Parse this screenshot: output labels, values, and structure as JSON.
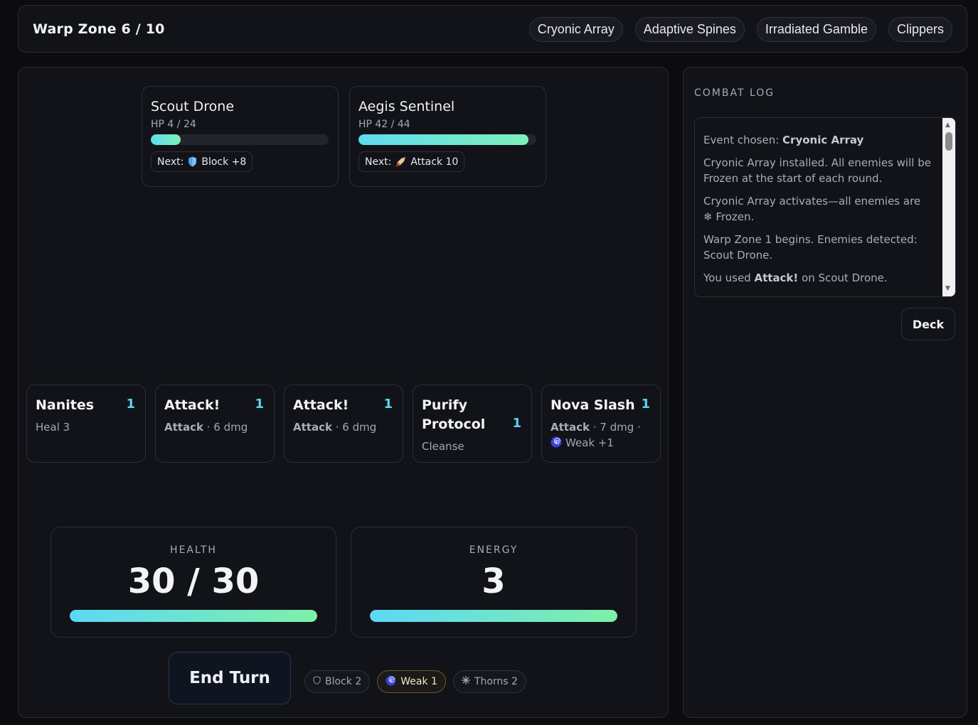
{
  "header": {
    "zone_title": "Warp Zone 6 / 10",
    "relics": [
      "Cryonic Array",
      "Adaptive Spines",
      "Irradiated Gamble",
      "Clippers"
    ]
  },
  "enemies": [
    {
      "name": "Scout Drone",
      "hp_text": "HP 4 / 24",
      "hp": 4,
      "hp_max": 24,
      "next_label": "Next:",
      "intent_icon": "shield-icon",
      "intent_text": "Block +8"
    },
    {
      "name": "Aegis Sentinel",
      "hp_text": "HP 42 / 44",
      "hp": 42,
      "hp_max": 44,
      "next_label": "Next:",
      "intent_icon": "dagger-icon",
      "intent_text": "Attack 10"
    }
  ],
  "hand": [
    {
      "name": "Nanites",
      "cost": "1",
      "type": "",
      "detail": "Heal 3"
    },
    {
      "name": "Attack!",
      "cost": "1",
      "type": "Attack",
      "detail": " · 6 dmg"
    },
    {
      "name": "Attack!",
      "cost": "1",
      "type": "Attack",
      "detail": " · 6 dmg"
    },
    {
      "name": "Purify Protocol",
      "cost": "1",
      "type": "",
      "detail": "Cleanse"
    },
    {
      "name": "Nova Slash",
      "cost": "1",
      "type": "Attack",
      "detail": " · 7 dmg ·",
      "extra": "Weak +1",
      "extra_icon": "spiral-icon"
    }
  ],
  "player": {
    "health_label": "HEALTH",
    "health_text": "30 / 30",
    "health": 30,
    "health_max": 30,
    "energy_label": "ENERGY",
    "energy_text": "3",
    "energy": 3,
    "energy_max": 3
  },
  "controls": {
    "end_turn_label": "End Turn",
    "deck_label": "Deck"
  },
  "buffs": [
    {
      "icon": "shield-outline-icon",
      "label": "Block 2",
      "active": false
    },
    {
      "icon": "spiral-icon",
      "label": "Weak 1",
      "active": true
    },
    {
      "icon": "spark-icon",
      "label": "Thorns 2",
      "active": false
    }
  ],
  "log": {
    "title": "COMBAT LOG",
    "entries": [
      {
        "pre": "Event chosen: ",
        "bold": "Cryonic Array",
        "post": ""
      },
      {
        "pre": "Cryonic Array installed. All enemies will be Frozen at the start of each round.",
        "bold": "",
        "post": ""
      },
      {
        "pre": "Cryonic Array activates—all enemies are ❄ Frozen.",
        "bold": "",
        "post": ""
      },
      {
        "pre": "Warp Zone 1 begins. Enemies detected: Scout Drone.",
        "bold": "",
        "post": ""
      },
      {
        "pre": "You used ",
        "bold": "Attack!",
        "post": " on Scout Drone."
      }
    ]
  },
  "colors": {
    "accent": "#5ad6f5",
    "bar_start": "#5fdcf0",
    "bar_end": "#7ef0b8",
    "weak": "#6b5a2a"
  }
}
